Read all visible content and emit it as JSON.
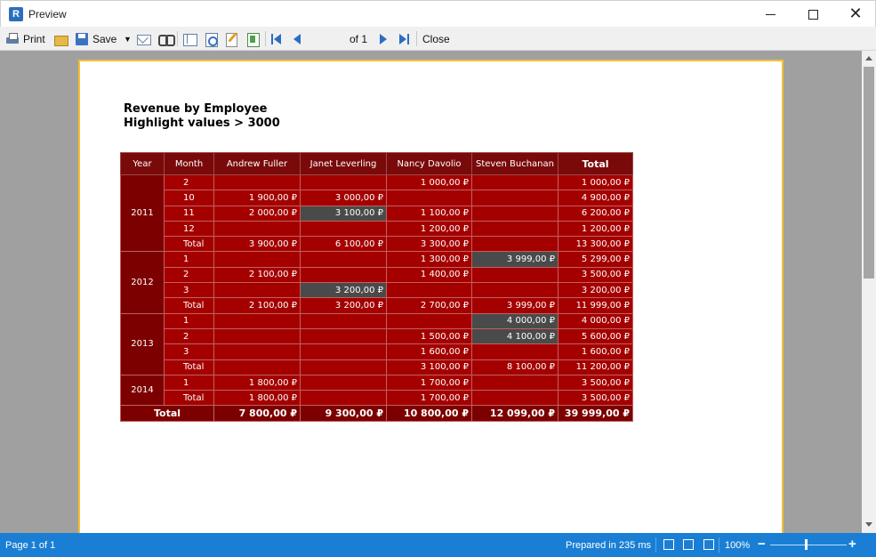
{
  "window": {
    "title": "Preview",
    "app_icon": "fastreport-icon"
  },
  "toolbar": {
    "print_label": "Print",
    "save_label": "Save",
    "page_value": "1",
    "page_of": "of 1",
    "close_label": "Close"
  },
  "report": {
    "title": "Revenue by Employee",
    "subtitle": "Highlight values > 3000",
    "columns": [
      "Year",
      "Month",
      "Andrew Fuller",
      "Janet Leverling",
      "Nancy Davolio",
      "Steven Buchanan",
      "Total"
    ],
    "rows": [
      {
        "year": "2011",
        "span": 5,
        "month": "2",
        "values": [
          "",
          "",
          "1 000,00 ₽",
          "",
          "1 000,00 ₽"
        ],
        "hl": []
      },
      {
        "month": "10",
        "values": [
          "1 900,00 ₽",
          "3 000,00 ₽",
          "",
          "",
          "4 900,00 ₽"
        ],
        "hl": []
      },
      {
        "month": "11",
        "values": [
          "2 000,00 ₽",
          "3 100,00 ₽",
          "1 100,00 ₽",
          "",
          "6 200,00 ₽"
        ],
        "hl": [
          1
        ]
      },
      {
        "month": "12",
        "values": [
          "",
          "",
          "1 200,00 ₽",
          "",
          "1 200,00 ₽"
        ],
        "hl": []
      },
      {
        "month": "Total",
        "values": [
          "3 900,00 ₽",
          "6 100,00 ₽",
          "3 300,00 ₽",
          "",
          "13 300,00 ₽"
        ],
        "hl": []
      },
      {
        "year": "2012",
        "span": 4,
        "month": "1",
        "values": [
          "",
          "",
          "1 300,00 ₽",
          "3 999,00 ₽",
          "5 299,00 ₽"
        ],
        "hl": [
          3
        ]
      },
      {
        "month": "2",
        "values": [
          "2 100,00 ₽",
          "",
          "1 400,00 ₽",
          "",
          "3 500,00 ₽"
        ],
        "hl": []
      },
      {
        "month": "3",
        "values": [
          "",
          "3 200,00 ₽",
          "",
          "",
          "3 200,00 ₽"
        ],
        "hl": [
          1
        ]
      },
      {
        "month": "Total",
        "values": [
          "2 100,00 ₽",
          "3 200,00 ₽",
          "2 700,00 ₽",
          "3 999,00 ₽",
          "11 999,00 ₽"
        ],
        "hl": []
      },
      {
        "year": "2013",
        "span": 4,
        "month": "1",
        "values": [
          "",
          "",
          "",
          "4 000,00 ₽",
          "4 000,00 ₽"
        ],
        "hl": [
          3
        ]
      },
      {
        "month": "2",
        "values": [
          "",
          "",
          "1 500,00 ₽",
          "4 100,00 ₽",
          "5 600,00 ₽"
        ],
        "hl": [
          3
        ]
      },
      {
        "month": "3",
        "values": [
          "",
          "",
          "1 600,00 ₽",
          "",
          "1 600,00 ₽"
        ],
        "hl": []
      },
      {
        "month": "Total",
        "values": [
          "",
          "",
          "3 100,00 ₽",
          "8 100,00 ₽",
          "11 200,00 ₽"
        ],
        "hl": []
      },
      {
        "year": "2014",
        "span": 2,
        "month": "1",
        "values": [
          "1 800,00 ₽",
          "",
          "1 700,00 ₽",
          "",
          "3 500,00 ₽"
        ],
        "hl": []
      },
      {
        "month": "Total",
        "values": [
          "1 800,00 ₽",
          "",
          "1 700,00 ₽",
          "",
          "3 500,00 ₽"
        ],
        "hl": []
      }
    ],
    "grand_total": {
      "label": "Total",
      "values": [
        "7 800,00 ₽",
        "9 300,00 ₽",
        "10 800,00 ₽",
        "12 099,00 ₽",
        "39 999,00 ₽"
      ]
    },
    "colors": {
      "cell": "#a40000",
      "header": "#7a0a0a",
      "highlight": "#4a4a4a"
    }
  },
  "statusbar": {
    "page_text": "Page 1 of 1",
    "prepared_text": "Prepared in 235 ms",
    "zoom_text": "100%",
    "zoom_fraction": 0.45
  }
}
